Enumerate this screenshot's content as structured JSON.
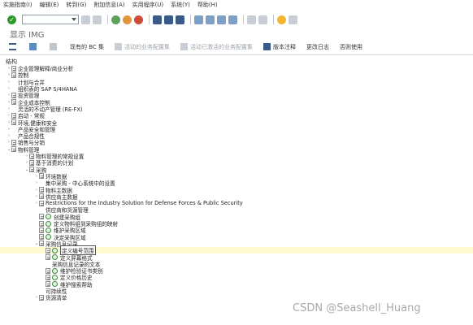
{
  "menu": [
    {
      "label": "实施指南(I)"
    },
    {
      "label": "编辑(E)"
    },
    {
      "label": "转到(G)"
    },
    {
      "label": "附加信息(A)"
    },
    {
      "label": "实用程序(U)"
    },
    {
      "label": "系统(Y)"
    },
    {
      "label": "帮助(H)"
    }
  ],
  "page_title": "显示 IMG",
  "app_toolbar": [
    {
      "label": "现有的 BC 集",
      "enabled": true
    },
    {
      "label": "活动的业务配置集",
      "enabled": false
    },
    {
      "label": "活动已激活的业务配置集",
      "enabled": false
    },
    {
      "label": "版本注释",
      "enabled": true
    },
    {
      "label": "更改日志",
      "enabled": true
    },
    {
      "label": "否则使用",
      "enabled": true
    }
  ],
  "tree_header": "结构",
  "tree": [
    {
      "level": 0,
      "exp": ">",
      "label": "企业管理解释/商业分析",
      "icon": "doc"
    },
    {
      "level": 0,
      "exp": ">",
      "label": "控制",
      "icon": "doc"
    },
    {
      "level": 0,
      "exp": ">",
      "label": "计划与合并",
      "icon": "none"
    },
    {
      "level": 0,
      "exp": ">",
      "label": "组织表的 SAP S/4HANA",
      "icon": "none"
    },
    {
      "level": 0,
      "exp": ">",
      "label": "投资管理",
      "icon": "doc"
    },
    {
      "level": 0,
      "exp": ">",
      "label": "企业成本控制",
      "icon": "doc"
    },
    {
      "level": 0,
      "exp": ">",
      "label": "灵活的不动产管理 (RE-FX)",
      "icon": "none"
    },
    {
      "level": 0,
      "exp": ">",
      "label": "启动 - 常规",
      "icon": "doc"
    },
    {
      "level": 0,
      "exp": ">",
      "label": "环境,健康和安全",
      "icon": "doc"
    },
    {
      "level": 0,
      "exp": ">",
      "label": "产品安全和管理",
      "icon": "none"
    },
    {
      "level": 0,
      "exp": ">",
      "label": "产品合规性",
      "icon": "none"
    },
    {
      "level": 0,
      "exp": ">",
      "label": "销售与分销",
      "icon": "doc"
    },
    {
      "level": 0,
      "exp": "v",
      "label": "物料管理",
      "icon": "doc"
    },
    {
      "level": 1,
      "exp": ">",
      "label": "物料管理的常规设置",
      "icon": "doc"
    },
    {
      "level": 1,
      "exp": ">",
      "label": "基于消费的计划",
      "icon": "doc"
    },
    {
      "level": 1,
      "exp": "v",
      "label": "采购",
      "icon": "doc"
    },
    {
      "level": 2,
      "exp": ">",
      "label": "环境数据",
      "icon": "doc"
    },
    {
      "level": 2,
      "exp": ">",
      "label": "集中采购 - 中心系统中的设置",
      "icon": "none"
    },
    {
      "level": 2,
      "exp": ">",
      "label": "物料主数据",
      "icon": "doc"
    },
    {
      "level": 2,
      "exp": ">",
      "label": "供应商主数据",
      "icon": "doc"
    },
    {
      "level": 2,
      "exp": ">",
      "label": "Restrictions for the Industry Solution for Defense Forces & Public Security",
      "icon": "doc"
    },
    {
      "level": 2,
      "exp": "",
      "label": "供应商和货源管理",
      "icon": "none"
    },
    {
      "level": 2,
      "exp": "",
      "label": "创建采购组",
      "icon": "doc-clock"
    },
    {
      "level": 2,
      "exp": "",
      "label": "定义物料组到采购组的映射",
      "icon": "doc-clock"
    },
    {
      "level": 2,
      "exp": "",
      "label": "维护采购区域",
      "icon": "doc-clock"
    },
    {
      "level": 2,
      "exp": "",
      "label": "决定采购区域",
      "icon": "doc-clock"
    },
    {
      "level": 2,
      "exp": "v",
      "label": "采购信息记录",
      "icon": "doc"
    },
    {
      "level": 3,
      "exp": "",
      "label": "定义编号范围",
      "icon": "doc-clock",
      "highlight": true
    },
    {
      "level": 3,
      "exp": "",
      "label": "定义屏幕格式",
      "icon": "doc-clock"
    },
    {
      "level": 3,
      "exp": "",
      "label": "采购信息记录的文本",
      "icon": "none"
    },
    {
      "level": 3,
      "exp": "",
      "label": "维护检验证书类别",
      "icon": "doc-clock"
    },
    {
      "level": 3,
      "exp": "",
      "label": "定义价格历史",
      "icon": "doc-clock"
    },
    {
      "level": 3,
      "exp": "",
      "label": "维护搜索帮助",
      "icon": "doc-clock"
    },
    {
      "level": 2,
      "exp": "",
      "label": "可持续性",
      "icon": "none"
    },
    {
      "level": 2,
      "exp": ">",
      "label": "货源清单",
      "icon": "doc"
    }
  ],
  "watermark": "CSDN @Seashell_Huang"
}
